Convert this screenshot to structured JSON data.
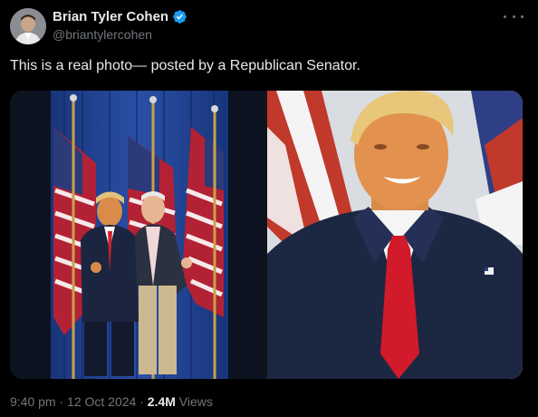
{
  "author": {
    "display_name": "Brian Tyler Cohen",
    "handle": "@briantylercohen",
    "verified": true,
    "badge_color": "#1d9bf0"
  },
  "tweet": {
    "text": "This is a real photo— posted by a Republican Senator."
  },
  "media": {
    "images": [
      {
        "name": "left-photo",
        "kind": "photo"
      },
      {
        "name": "right-photo",
        "kind": "photo"
      }
    ]
  },
  "meta": {
    "time": "9:40 pm",
    "separator1": " · ",
    "date": "12 Oct 2024",
    "separator2": " · ",
    "views_count": "2.4M",
    "views_label": " Views"
  },
  "icons": {
    "more": "more-horizontal-icon",
    "verified": "verified-badge-icon"
  },
  "colors": {
    "background": "#000000",
    "text_primary": "#e7e9ea",
    "text_secondary": "#71767b"
  }
}
